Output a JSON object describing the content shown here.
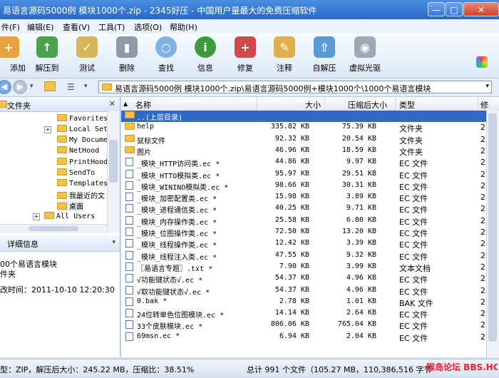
{
  "window": {
    "title": "易语言源码5000例 模块1000个.zip - 2345好压 - 中国用户量最大的免费压缩软件",
    "min_label": "—",
    "max_label": "□",
    "close_label": "✕"
  },
  "menu": [
    "件(F)",
    "编辑(E)",
    "查看(V)",
    "工具(T)",
    "选项(O)",
    "帮助(H)"
  ],
  "toolbar": [
    "添加",
    "解压到",
    "测试",
    "删除",
    "查找",
    "信息",
    "修复",
    "注释",
    "自解压",
    "虚拟光驱"
  ],
  "toolbar_icons": [
    "add-icon",
    "extract-icon",
    "test-icon",
    "delete-icon",
    "find-icon",
    "info-icon",
    "repair-icon",
    "comment-icon",
    "sfx-icon",
    "virtual-drive-icon"
  ],
  "address": {
    "path": "易语言源码5000例 模块1000个.zip\\易语言源码5000例+模块1000个\\1000个易语言模块"
  },
  "left_pane": {
    "folders_title": "文件夹",
    "tree": [
      "Favorites",
      "Local Set",
      "My Docume",
      "NetHood",
      "PrintHood",
      "SendTo",
      "Templates",
      "我最近的文",
      "桌面",
      "All Users"
    ],
    "details_title": "详细信息",
    "detail_name": "00个易语言模块",
    "detail_type": "件夹",
    "detail_mtime": "改时间：2011-10-10 12:20:30"
  },
  "columns": {
    "name": "名称",
    "size": "大小",
    "packed": "压缩后大小",
    "type": "类型",
    "extra": "修"
  },
  "files": [
    {
      "name": "..(上层目录)",
      "size": "",
      "packed": "",
      "type": "",
      "extra": "",
      "kind": "up"
    },
    {
      "name": "help",
      "size": "335.82 KB",
      "packed": "75.39 KB",
      "type": "文件夹",
      "extra": "2",
      "kind": "folder"
    },
    {
      "name": "鼠标文件",
      "size": "92.32 KB",
      "packed": "20.54 KB",
      "type": "文件夹",
      "extra": "2",
      "kind": "folder"
    },
    {
      "name": "图片",
      "size": "46.96 KB",
      "packed": "18.59 KB",
      "type": "文件夹",
      "extra": "2",
      "kind": "folder"
    },
    {
      "name": "_模块_HTTP访问类.ec *",
      "size": "44.86 KB",
      "packed": "9.97 KB",
      "type": "EC 文件",
      "extra": "2",
      "kind": "file"
    },
    {
      "name": "_模块_HTTO模拟类.ec *",
      "size": "95.97 KB",
      "packed": "29.51 KB",
      "type": "EC 文件",
      "extra": "2",
      "kind": "file"
    },
    {
      "name": "_模块_WININO模拟类.ec *",
      "size": "98.66 KB",
      "packed": "30.31 KB",
      "type": "EC 文件",
      "extra": "2",
      "kind": "file"
    },
    {
      "name": "_模块_加密配置类.ec *",
      "size": "15.98 KB",
      "packed": "3.89 KB",
      "type": "EC 文件",
      "extra": "2",
      "kind": "file"
    },
    {
      "name": "_模块_进程通信类.ec *",
      "size": "40.25 KB",
      "packed": "9.71 KB",
      "type": "EC 文件",
      "extra": "2",
      "kind": "file"
    },
    {
      "name": "_模块_内存操作类.ec *",
      "size": "25.58 KB",
      "packed": "6.80 KB",
      "type": "EC 文件",
      "extra": "2",
      "kind": "file"
    },
    {
      "name": "_模块_位图操作类.ec *",
      "size": "72.50 KB",
      "packed": "13.20 KB",
      "type": "EC 文件",
      "extra": "2",
      "kind": "file"
    },
    {
      "name": "_模块_线程操作类.ec *",
      "size": "12.42 KB",
      "packed": "3.39 KB",
      "type": "EC 文件",
      "extra": "2",
      "kind": "file"
    },
    {
      "name": "_模块_线程注入类.ec *",
      "size": "47.55 KB",
      "packed": "9.32 KB",
      "type": "EC 文件",
      "extra": "2",
      "kind": "file"
    },
    {
      "name": "〖易语言专题〗.txt *",
      "size": "7.90 KB",
      "packed": "3.99 KB",
      "type": "文本文档",
      "extra": "2",
      "kind": "file"
    },
    {
      "name": "√功能键状态√.ec *",
      "size": "54.37 KB",
      "packed": "4.96 KB",
      "type": "EC 文件",
      "extra": "2",
      "kind": "file"
    },
    {
      "name": "√取功能键状态√.ec *",
      "size": "54.37 KB",
      "packed": "4.96 KB",
      "type": "EC 文件",
      "extra": "2",
      "kind": "file"
    },
    {
      "name": "0.bak *",
      "size": "2.78 KB",
      "packed": "1.01 KB",
      "type": "BAK 文件",
      "extra": "2",
      "kind": "file"
    },
    {
      "name": "24位转单色位图模块.ec *",
      "size": "14.14 KB",
      "packed": "2.64 KB",
      "type": "EC 文件",
      "extra": "2",
      "kind": "file"
    },
    {
      "name": "33个皮肤模块.ec *",
      "size": "806.06 KB",
      "packed": "765.04 KB",
      "type": "EC 文件",
      "extra": "2",
      "kind": "file"
    },
    {
      "name": "69msn.ec *",
      "size": "6.94 KB",
      "packed": "2.04 KB",
      "type": "EC 文件",
      "extra": "2",
      "kind": "file"
    }
  ],
  "status": {
    "left": "型：ZIP，解压后大小：245.22 MB，压缩比：38.51%",
    "right": "总计 991 个文件（105.27 MB，110,386,516 字节"
  },
  "watermark": "猴岛论坛 BBS.HOUDAO.COM"
}
